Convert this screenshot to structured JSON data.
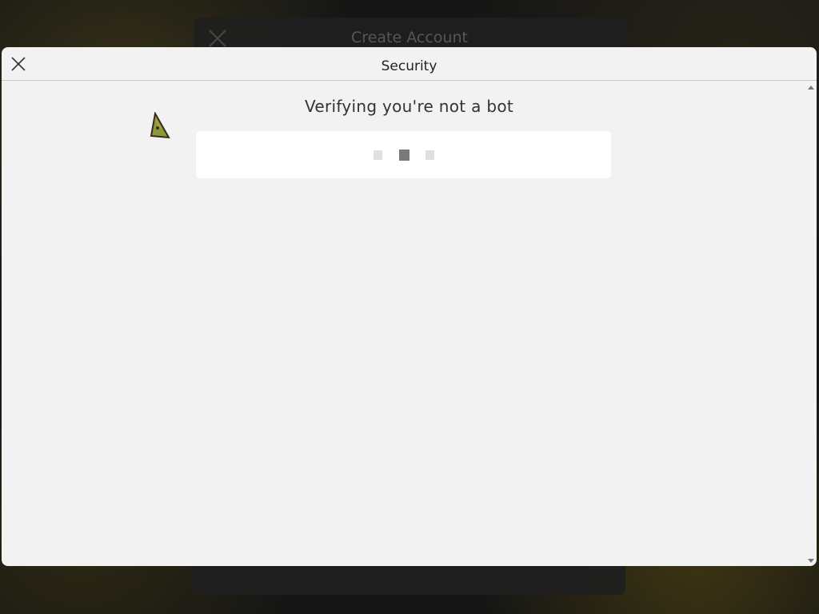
{
  "background_dialog": {
    "title": "Create Account",
    "close_icon": "close-icon"
  },
  "modal": {
    "title": "Security",
    "close_icon": "close-icon",
    "verify_text": "Verifying you're not a bot",
    "loader": {
      "dots": 3,
      "active_index": 1
    }
  },
  "cursor_icon": "custom-cursor-icon",
  "colors": {
    "modal_bg": "#f2f2f2",
    "loader_bg": "#ffffff",
    "dot_active": "#7a7a7a",
    "dot_inactive": "#e0e0e0"
  }
}
